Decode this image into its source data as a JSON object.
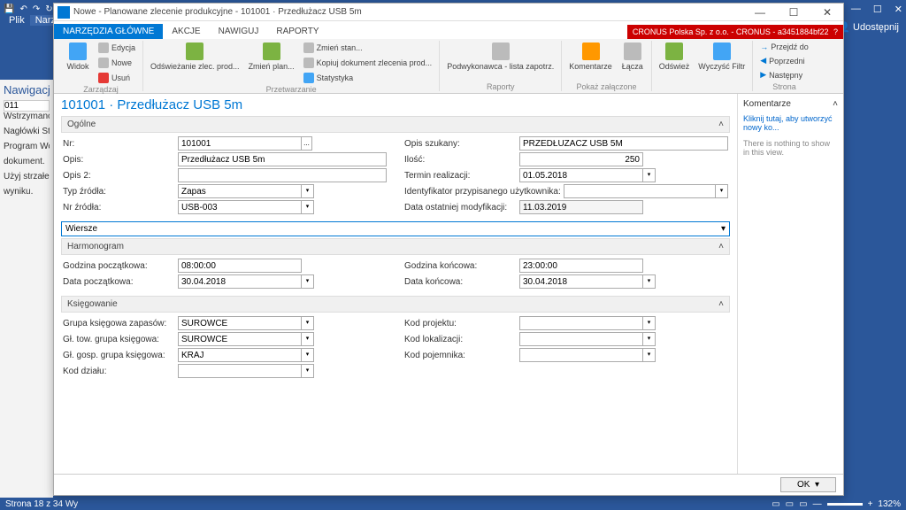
{
  "word": {
    "titlebar_icons": [
      "💾",
      "↶",
      "↷",
      "↻"
    ],
    "share": "Udostępnij",
    "panel_header": "Nawigacja",
    "panel_search": "011",
    "panel_lines": [
      "Wstrzymano wyszu",
      "Nagłówki    Str",
      "Program Word wst",
      "dokument.",
      "Użyj strzałek, aby ko",
      "wyniku."
    ],
    "status_left": "Strona 18 z 34    Wy",
    "zoom": "132%"
  },
  "nav": {
    "title": "Nowe - Planowane zlecenie produkcyjne - 101001 · Przedłużacz USB 5m",
    "tabs": [
      "NARZĘDZIA GŁÓWNE",
      "AKCJE",
      "NAWIGUJ",
      "RAPORTY"
    ],
    "company": "CRONUS Polska Sp. z o.o. - CRONUS - a3451884bf22",
    "ribbon": {
      "g1": {
        "label": "Zarządzaj",
        "widok": "Widok",
        "edycja": "Edycja",
        "nowe": "Nowe",
        "usun": "Usuń"
      },
      "g2": {
        "label": "Przetwarzanie",
        "odswiez": "Odświeżanie zlec. prod...",
        "zmien": "Zmień plan...",
        "zmienstan": "Zmień stan...",
        "kopiuj": "Kopiuj dokument zlecenia prod...",
        "stat": "Statystyka"
      },
      "g3": {
        "label": "Raporty",
        "pod": "Podwykonawca - lista zapotrz."
      },
      "g4": {
        "label": "Pokaż załączone",
        "kom": "Komentarze",
        "lacza": "Łącza"
      },
      "g5": {
        "odswiez": "Odśwież",
        "wyczysc": "Wyczyść Filtr"
      },
      "g6": {
        "label": "Strona",
        "przejdz": "Przejdź do",
        "poprz": "Poprzedni",
        "nast": "Następny"
      }
    },
    "page_title": "101001 · Przedłużacz USB 5m",
    "sections": {
      "ogolne": {
        "header": "Ogólne",
        "nr_label": "Nr:",
        "nr": "101001",
        "opis_label": "Opis:",
        "opis": "Przedłużacz USB 5m",
        "opis2_label": "Opis 2:",
        "opis2": "",
        "typ_label": "Typ źródła:",
        "typ": "Zapas",
        "nrzr_label": "Nr źródła:",
        "nrzr": "USB-003",
        "opissz_label": "Opis szukany:",
        "opissz": "PRZEDŁUŻACZ USB 5M",
        "ilosc_label": "Ilość:",
        "ilosc": "250",
        "termin_label": "Termin realizacji:",
        "termin": "01.05.2018",
        "ident_label": "Identyfikator przypisanego użytkownika:",
        "ident": "",
        "datamod_label": "Data ostatniej modyfikacji:",
        "datamod": "11.03.2019"
      },
      "wiersze": {
        "header": "Wiersze"
      },
      "harmon": {
        "header": "Harmonogram",
        "gp_label": "Godzina początkowa:",
        "gp": "08:00:00",
        "dp_label": "Data początkowa:",
        "dp": "30.04.2018",
        "gk_label": "Godzina końcowa:",
        "gk": "23:00:00",
        "dk_label": "Data końcowa:",
        "dk": "30.04.2018"
      },
      "ksieg": {
        "header": "Księgowanie",
        "gkz_label": "Grupa księgowa zapasów:",
        "gkz": "SUROWCE",
        "gtgk_label": "Gł. tow. grupa księgowa:",
        "gtgk": "SUROWCE",
        "ggsk_label": "Gł. gosp. grupa księgowa:",
        "ggsk": "KRAJ",
        "kd_label": "Kod działu:",
        "kd": "",
        "kp_label": "Kod projektu:",
        "kp": "",
        "kl_label": "Kod lokalizacji:",
        "kl": "",
        "kpoj_label": "Kod pojemnika:",
        "kpoj": ""
      }
    },
    "comments": {
      "header": "Komentarze",
      "link": "Kliknij tutaj, aby utworzyć nowy ko...",
      "empty": "There is nothing to show in this view."
    },
    "footer_ok": "OK"
  }
}
